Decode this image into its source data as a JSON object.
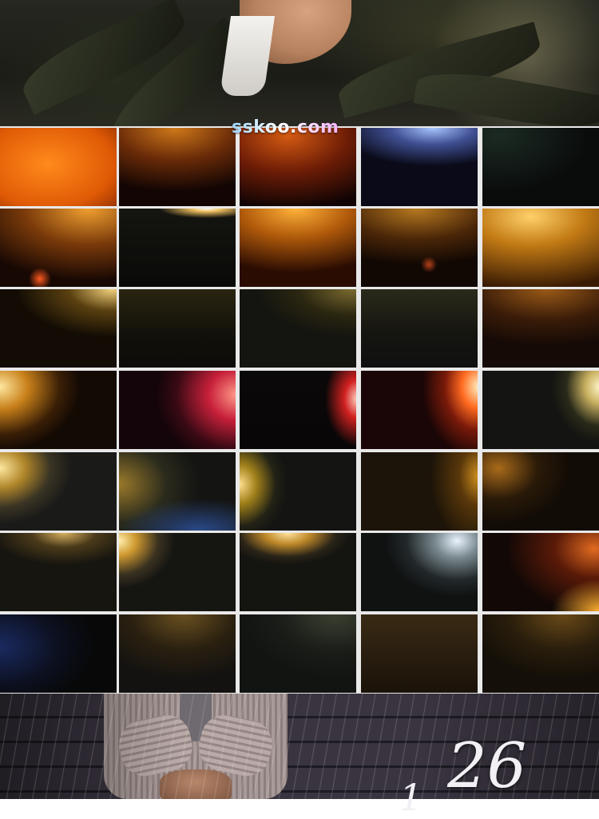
{
  "watermark": "sskoo.com",
  "bottom_numeral": "26",
  "bottom_numeral_prefix": "1",
  "grid": {
    "rows": [
      [
        {
          "bg": "radial-gradient(ellipse 180px 120px at 60px 45px, #ff8a1c 0%, #e05a05 45%, #6a1b02 80%, #1a0500 100%)"
        },
        {
          "bg": "radial-gradient(ellipse 150px 80px at 70px 0px, #d07a1a 0%, #6a2b08 50%, #120503 100%)"
        },
        {
          "bg": "radial-gradient(ellipse 150px 90px at 60px 10px, #d35a12 0%, #6e1d06 50%, #120404 100%)"
        },
        {
          "bg": "radial-gradient(ellipse 150px 60px at 90px 0px, #a9c6ff 0%, #3f4f92 35%, #0a0a18 80%)"
        },
        {
          "bg": "radial-gradient(ellipse 160px 100px at 20px 10px, #1b2a22 0%, #0a0c0c 70%)"
        }
      ],
      [
        {
          "bg": "radial-gradient(circle 14px at 50px 88px, #ff5a20 0%, transparent 100%), radial-gradient(ellipse 160px 90px at 110px 0px, #f0a030 0%, #7a3a0a 50%, #180803 100%)"
        },
        {
          "bg": "radial-gradient(ellipse 60px 12px at 110px 0px, #ffffff 0%, #f0c060 30%, transparent 100%), linear-gradient(#141410, #0a0a08)"
        },
        {
          "bg": "radial-gradient(ellipse 150px 80px at 70px 0px, #ffb23a 0%, #b05a0a 45%, #2a0c02 100%)"
        },
        {
          "bg": "radial-gradient(circle 10px at 85px 70px, #b5401a 0%, transparent 100%), radial-gradient(ellipse 160px 70px at 70px 0px, #b87a20 0%, #4a2608 55%, #120803 100%)"
        },
        {
          "bg": "radial-gradient(ellipse 170px 90px at 60px 10px, #ffd06a 0%, #c27a14 40%, #3a1c04 100%)"
        }
      ],
      [
        {
          "bg": "radial-gradient(ellipse 120px 60px at 140px 0px, #f0d07a 0%, #5a4010 45%, #120c04 100%)"
        },
        {
          "bg": "linear-gradient(180deg, #2a2410 0%, #11100a 60%, #0c0b08 100%)"
        },
        {
          "bg": "radial-gradient(ellipse 120px 60px at 140px 0px, #7a6a30 0%, #2a2610 55%, #141410 100%)"
        },
        {
          "bg": "linear-gradient(180deg, #2a2a1a 0%, #141410 60%, #101010 100%)"
        },
        {
          "bg": "radial-gradient(ellipse 160px 70px at 80px 0px, #9a5a18 0%, #3a1c08 55%, #160a06 100%)"
        }
      ],
      [
        {
          "bg": "radial-gradient(ellipse 100px 80px at 0px 20px, #ffe7a0 0%, #c8801a 35%, #3a1f06 75%, #140a04 100%)"
        },
        {
          "bg": "radial-gradient(ellipse 100px 90px at 147px 30px, #ff9a8a 0%, #c8203a 35%, #3a0a14 75%, #14050a 100%)"
        },
        {
          "bg": "radial-gradient(ellipse 40px 60px at 147px 35px, #ffd0c0 0%, #d02020 40%, transparent 100%), linear-gradient(#0a0808, #080606)"
        },
        {
          "bg": "radial-gradient(ellipse 70px 90px at 147px 20px, #fff0c0 0%, #ff6a20 30%, #7a1a0a 60%, #1a0606 100%)"
        },
        {
          "bg": "radial-gradient(ellipse 60px 70px at 147px 20px, #fff6c8 0%, #c8b060 30%, #2a2a1a 70%, #141412 100%)"
        }
      ],
      [
        {
          "bg": "radial-gradient(ellipse 90px 70px at 0px 20px, #ffe8a0 0%, #b0862a 35%, #3a3424 70%, #1a1a18 100%)"
        },
        {
          "bg": "radial-gradient(ellipse 100px 40px at 100px 98px, #2a4a8a 0%, transparent 100%), radial-gradient(ellipse 100px 80px at 0px 40px, #9a7a2a 0%, #2a2a1c 60%, #141412 100%)"
        },
        {
          "bg": "radial-gradient(ellipse 60px 70px at 0px 40px, #ffe090 0%, #a0801a 35%, #222216 75%, #141412 100%)"
        },
        {
          "bg": "radial-gradient(ellipse 60px 90px at 147px 30px, #d09020 0%, #5a380a 40%, #1c1408 100%)"
        },
        {
          "bg": "radial-gradient(ellipse 90px 70px at 20px 20px, #a86a1a 0%, #2a1a08 55%, #120c06 100%)"
        }
      ],
      [
        {
          "bg": "radial-gradient(ellipse 90px 40px at 80px 0px, #d8b060 0%, #4a3a1a 45%, #16150f 100%)"
        },
        {
          "bg": "radial-gradient(ellipse 70px 60px at 0px 10px, #fff0b0 0%, #d09a30 30%, #3a3220 70%, #151512 100%)"
        },
        {
          "bg": "radial-gradient(ellipse 80px 40px at 60px 0px, #ffe4a0 0%, #c08a2a 35%, #2a2418 75%, #141410 100%)"
        },
        {
          "bg": "radial-gradient(ellipse 90px 70px at 120px 10px, #eaf3ff 0%, #7a8a90 30%, #22282a 70%, #101212 100%)"
        },
        {
          "bg": "radial-gradient(ellipse 60px 40px at 147px 98px, #ffb030 0%, transparent 100%), radial-gradient(ellipse 110px 80px at 140px 20px, #e06a20 0%, #5a1a08 45%, #120806 100%)"
        }
      ],
      [
        {
          "bg": "radial-gradient(ellipse 120px 80px at 0px 40px, #1a2a60 0%, #0c1020 60%, #080808 100%)"
        },
        {
          "bg": "radial-gradient(ellipse 120px 80px at 80px 0px, #6a5020 0%, #2a2010 55%, #141210 100%)"
        },
        {
          "bg": "radial-gradient(ellipse 120px 80px at 120px 0px, #3a4030 0%, #1a1c18 60%, #121412 100%)"
        },
        {
          "bg": "linear-gradient(180deg, #3a2a14 0%, #2a1e10 50%, #1a1208 100%)"
        },
        {
          "bg": "radial-gradient(ellipse 120px 80px at 100px 0px, #6a4a18 0%, #2a1e0c 55%, #140f08 100%)"
        }
      ]
    ]
  }
}
